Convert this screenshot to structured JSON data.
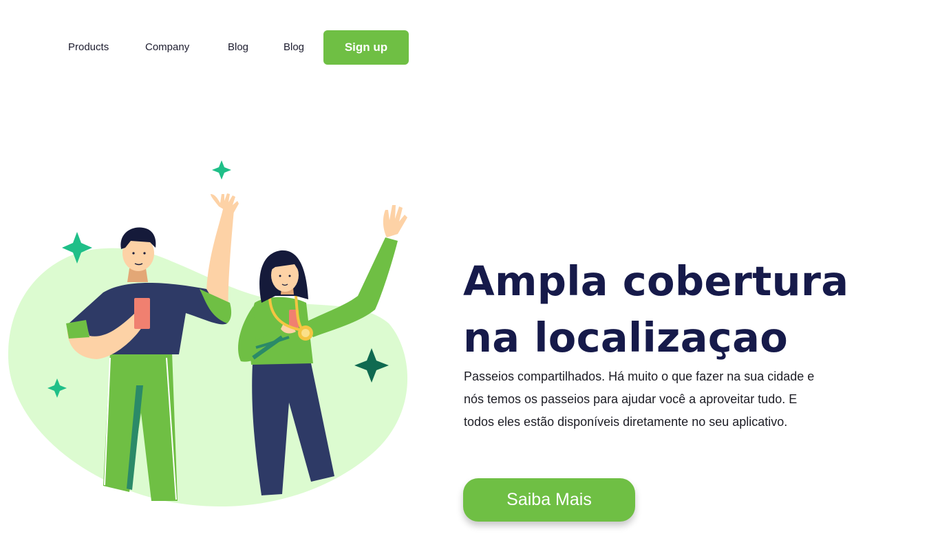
{
  "nav": {
    "links": [
      "Products",
      "Company",
      "Blog",
      "Blog"
    ],
    "signup_label": "Sign up"
  },
  "hero": {
    "title_line1": "Ampla cobertura",
    "title_line2": "na localizaçao",
    "description": "Passeios compartilhados. Há muito o que fazer na sua cidade e nós temos os passeios para ajudar você a aproveitar tudo. E todos eles estão disponíveis diretamente no seu aplicativo.",
    "cta_label": "Saiba Mais"
  },
  "colors": {
    "accent": "#6fbf44",
    "title": "#161a4a",
    "blob": "#dcfbd0",
    "navy": "#2e3a66"
  }
}
